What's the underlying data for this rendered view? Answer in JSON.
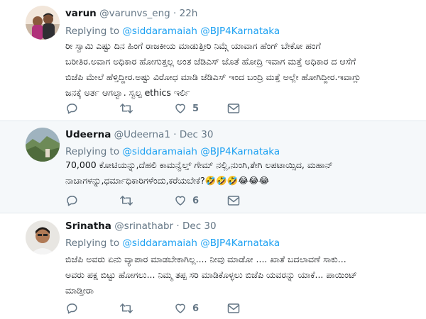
{
  "tweets": [
    {
      "name": "varun",
      "handle": "@varunvs_eng",
      "dot": "·",
      "time": "22h",
      "replying_prefix": "Replying to",
      "mentions": [
        "@siddaramaiah",
        "@BJP4Karnataka"
      ],
      "lines": [
        "ರೀ ಸ್ವಾಮಿ ಎಷ್ಟು ದಿನ ಹಿಂಗೆ ರಾಜಕೀಯ ಮಾಡುತ್ತೀರಿ ನಿಮ್ಗೆ ಯಾವಾಗ ಹೆಂಗ್ ಬೇಕೋ ಹಂಗೆ",
        "ಬರೀತಿರ.ಅವಾಗ ಅಧಿಕಾರ ಹೋಗುತ್ತಲ್ಲ ಅಂತ ಜೆಡಿಎಸ್ ಜೊತೆ ಹೋದ್ರಿ ಇವಾಗ ಮತ್ತೆ ಅಧಿಕಾರ ದ ಆಸೆಗೆ",
        "ಬಿಜೆಪಿ ಮೇಲೆ ಹೆಳ್ತಿದ್ದೀರ.ಅಷ್ಟು ವಿರೋಧ ಮಾಡಿ ಜೆಡಿಎಸ್ ಇಂದ ಬಂದ್ರಿ ಮತ್ತೆ ಅಲ್ಲೇ ಹೋಗಿದ್ದೀರ.ಇವಾಗ್ಲು",
        "ಜನಕ್ಕೆ ಅರ್ತ ಆಗಲ್ವಾ. ಸ್ವಲ್ಪ ethics ಇರ್ಲಿ"
      ],
      "likes": "5"
    },
    {
      "name": "Udeerna",
      "handle": "@Udeerna1",
      "dot": "·",
      "time": "Dec 30",
      "replying_prefix": "Replying to",
      "mentions": [
        "@siddaramaiah",
        "@BJP4Karnataka"
      ],
      "lines": [
        "70,000 ಕೋಟಿಯನ್ನು,ದೆಹಲಿ ಕಾಮನ್ವೆಲ್ತ್ ಗೇಮ್ ನಲ್ಲಿ,ನುಂಗಿ,ತೇಗಿ ಲಪಟಾಯ್ಸಿದ, ಮಹಾನ್",
        "ನಾಚಾಗಳನ್ನು,ಧರ್ಮಾಧಿಕಾರಿಗಳೆಂದು,ಕರೆಯಬೇಕೆ?🤣🤣🤣😂😂😂"
      ],
      "likes": "6"
    },
    {
      "name": "Srinatha",
      "handle": "@srinathabr",
      "dot": "·",
      "time": "Dec 30",
      "replying_prefix": "Replying to",
      "mentions": [
        "@siddaramaiah",
        "@BJP4Karnataka"
      ],
      "lines": [
        "ಬಿಜೆಪಿ ಅವರು ಏನು ವ್ಯಾಪಾರ ಮಾಡಬೇಕಾಗಿಲ್ಲ.... ನೀವು ಮಾಡೋ .... ಖಾತೆ ಬದಲಾವಣೆ ಸಾಕು...",
        "ಅವರು ಪಕ್ಷ ಬಿಟ್ಟು ಹೋಗಲು... ನಿಮ್ಮ ತಪ್ಪ ಸರಿ ಮಾಡಿಕೊಳ್ಳಲು ಬಿಜೆಪಿ ಯವರನ್ನು ಯಾಕೆ... ಪಾಯಿಂಟ್",
        "ಮಾಡ್ತೀರಾ"
      ],
      "likes": "6"
    }
  ],
  "icons": {
    "reply": "reply-icon",
    "retweet": "retweet-icon",
    "like": "heart-icon",
    "message": "envelope-icon"
  },
  "colors": {
    "link": "#1da1f2",
    "secondary_text": "#657786",
    "highlight_bg": "#f5f8fa",
    "divider": "#e1e8ed"
  }
}
